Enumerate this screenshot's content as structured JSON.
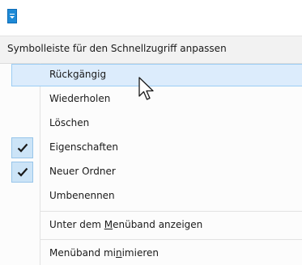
{
  "qat": {
    "customize_icon": "qat-customize-dropdown-icon"
  },
  "menu": {
    "header": "Symbolleiste für den Schnellzugriff anpassen",
    "items": [
      {
        "label": "Rückgängig",
        "checked": false
      },
      {
        "label": "Wiederholen",
        "checked": false
      },
      {
        "label": "Löschen",
        "checked": false
      },
      {
        "label": "Eigenschaften",
        "checked": true
      },
      {
        "label": "Neuer Ordner",
        "checked": true
      },
      {
        "label": "Umbenennen",
        "checked": false
      }
    ],
    "options": {
      "show_below": {
        "before": "Unter dem ",
        "accel": "M",
        "after": "enüband anzeigen"
      },
      "minimize": {
        "before": "Menüband mi",
        "accel": "n",
        "after": "imieren"
      }
    }
  },
  "colors": {
    "hover_fill": "#dcecfc",
    "hover_border": "#9ccdf4",
    "check_fill": "#cce4f7",
    "qat_button": "#1e8ad6"
  }
}
